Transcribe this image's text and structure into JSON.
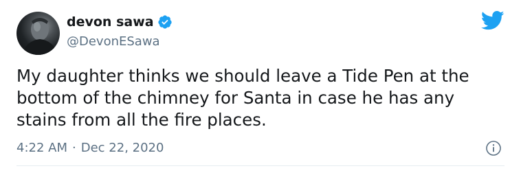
{
  "tweet": {
    "display_name": "devon sawa",
    "handle": "@DevonESawa",
    "text": "My daughter thinks we should leave a Tide Pen at the\nbottom of the chimney for Santa in case he has any\nstains from all the fire places.",
    "time": "4:22 AM",
    "separator": "·",
    "date": "Dec 22, 2020"
  },
  "icons": {
    "verified": "verified-badge-icon",
    "brand": "twitter-bird-icon",
    "info": "info-icon"
  },
  "colors": {
    "brand_blue": "#1da1f2",
    "muted": "#5b7083",
    "text": "#14171a"
  }
}
